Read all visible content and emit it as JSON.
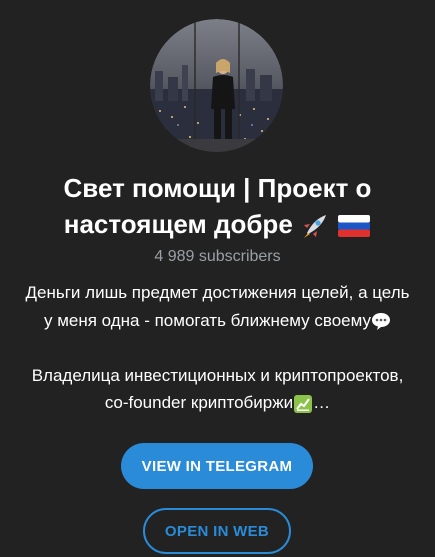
{
  "channel": {
    "title_line1": "Свет помощи | Проект о",
    "title_line2": "настоящем добре",
    "title_emoji": [
      "rocket-emoji",
      "russia-flag-emoji"
    ],
    "subscribers": "4 989 subscribers",
    "description": {
      "line1": "Деньги лишь предмет достижения целей, а цель",
      "line2": "у меня одна - помогать ближнему своему",
      "line2_emoji": "speech-bubble-emoji",
      "line3": "Владелица инвестиционных и криптопроектов,",
      "line4": "co-founder криптобиржи",
      "line4_emoji": "chart-emoji",
      "line4_suffix": "…"
    }
  },
  "buttons": {
    "view_in_telegram": "VIEW IN TELEGRAM",
    "open_in_web": "OPEN IN WEB"
  },
  "colors": {
    "background": "#222222",
    "accent": "#2a8bd8",
    "muted_text": "#9aa0a6"
  }
}
